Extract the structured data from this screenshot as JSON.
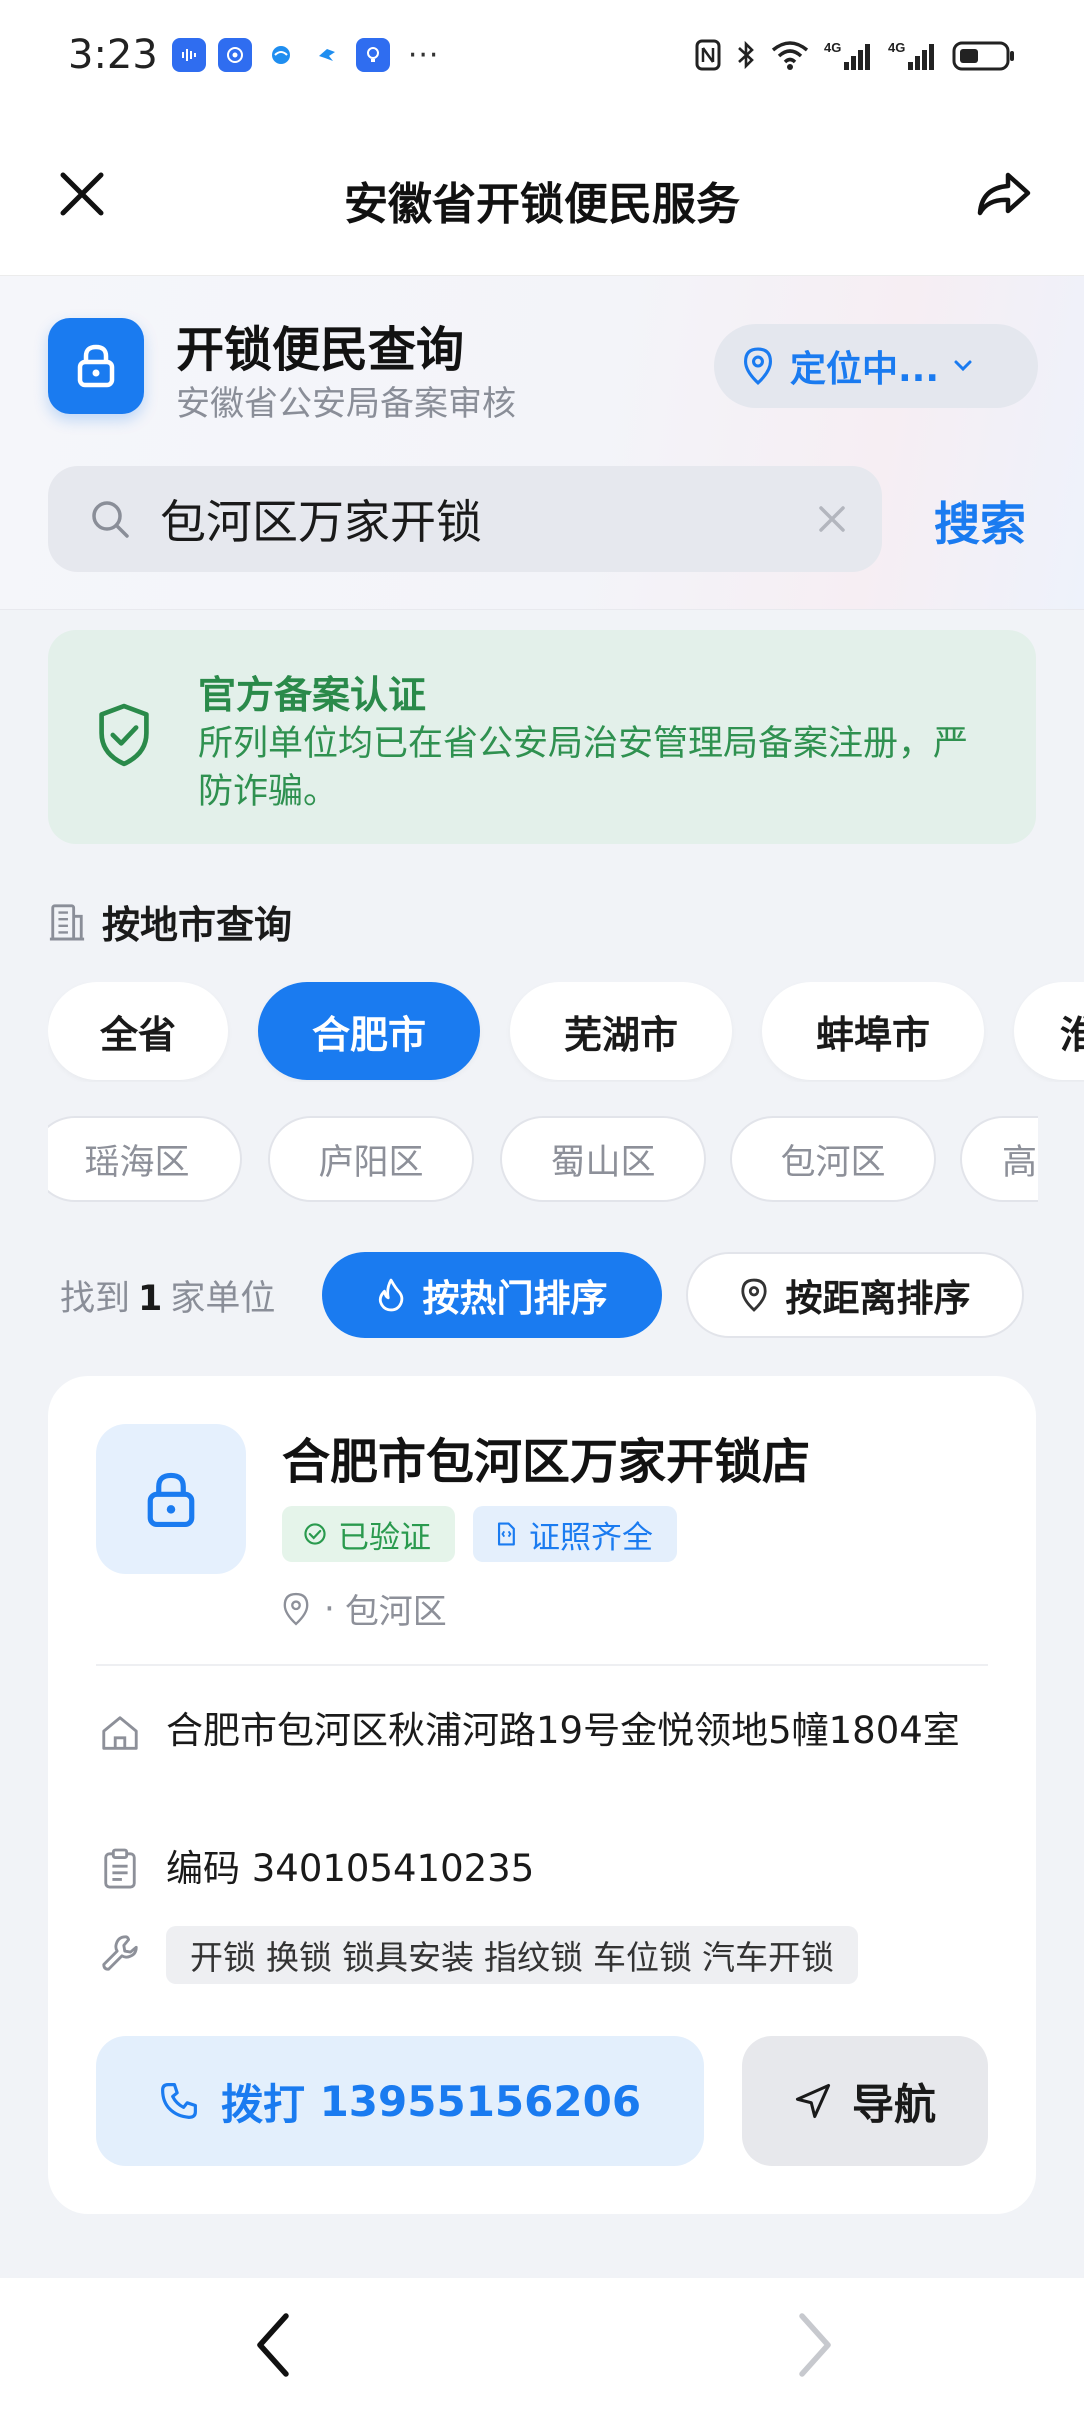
{
  "status_bar": {
    "time": "3:23",
    "more": "···",
    "network_1": "4G",
    "network_2": "4G",
    "icons": [
      "nfc-icon",
      "bluetooth-icon",
      "wifi-icon",
      "signal-icon",
      "battery-icon"
    ]
  },
  "title_bar": {
    "title": "安徽省开锁便民服务"
  },
  "header": {
    "brand_title": "开锁便民查询",
    "brand_subtitle": "安徽省公安局备案审核",
    "location": "定位中...",
    "search_value": "包河区万家开锁",
    "search_button": "搜索"
  },
  "notice": {
    "title": "官方备案认证",
    "body": "所列单位均已在省公安局治安管理局备案注册，严防诈骗。"
  },
  "filter": {
    "section_label": "按地市查询",
    "cities": [
      "全省",
      "合肥市",
      "芜湖市",
      "蚌埠市",
      "淮"
    ],
    "active_city": "合肥市",
    "districts": [
      "瑶海区",
      "庐阳区",
      "蜀山区",
      "包河区",
      "高"
    ]
  },
  "sort": {
    "prefix": "找到",
    "count": "1",
    "suffix": "家单位",
    "hot": "按热门排序",
    "distance": "按距离排序",
    "active": "hot"
  },
  "results": [
    {
      "name": "合肥市包河区万家开锁店",
      "badge_verified": "已验证",
      "badge_license": "证照齐全",
      "district_sep": "·",
      "district": "包河区",
      "address": "合肥市包河区秋浦河路19号金悦领地5幢1804室",
      "code_label": "编码",
      "code": "340105410235",
      "services": [
        "开锁",
        "换锁",
        "锁具安装",
        "指纹锁",
        "车位锁",
        "汽车开锁"
      ],
      "call_label": "拨打",
      "phone": "13955156206",
      "nav_label": "导航"
    }
  ],
  "colors": {
    "accent": "#1a7bf0",
    "success": "#2a8a4a",
    "notice_bg": "#e3f0ea",
    "page_bg": "#f1f3f7"
  }
}
